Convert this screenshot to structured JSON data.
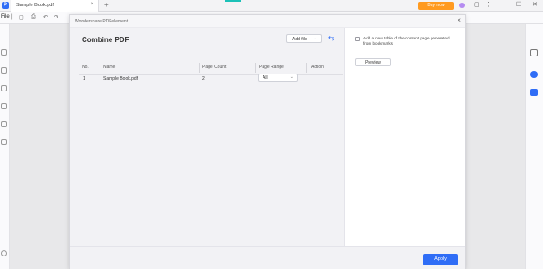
{
  "titlebar": {
    "tab_label": "Sample Book.pdf",
    "tab_close": "×",
    "new_tab": "+",
    "buy_now": "Buy now",
    "minimize": "—",
    "maximize": "☐",
    "close": "✕"
  },
  "toolbar": {
    "file_label": "File"
  },
  "dialog": {
    "title": "Wondershare PDFelement",
    "close": "×",
    "heading": "Combine PDF",
    "add_file_label": "Add file",
    "columns": [
      "No.",
      "Name",
      "Page Count",
      "Page Range",
      "Action"
    ],
    "rows": [
      {
        "no": "1",
        "name": "Sample Book.pdf",
        "page_count": "2",
        "page_range": "All"
      }
    ],
    "checkbox_text": "Add a new table of the content page generated from bookmarks",
    "preview_label": "Preview",
    "apply_label": "Apply"
  },
  "colors": {
    "accent": "#2f6df6",
    "buy_now": "#ff9a1f",
    "teal": "#1cc1b8"
  }
}
